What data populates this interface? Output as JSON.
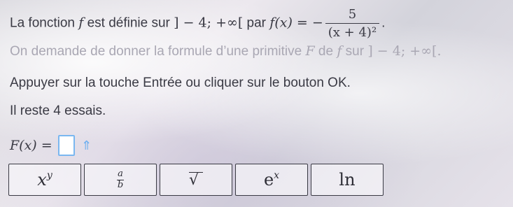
{
  "statement": {
    "text_a": "La fonction ",
    "f_symbol": "f",
    "text_b": " est définie sur ",
    "domain": "] − 4; +∞[",
    "text_c": " par ",
    "f_of_x": "f(x) = −",
    "numerator": "5",
    "denominator": "(x + 4)²",
    "end": "."
  },
  "question": {
    "text_a": "On demande de donner la formule d’une primitive ",
    "F_symbol": "F",
    "text_b": " de ",
    "f_symbol": "f",
    "text_c": " sur ",
    "domain": "] − 4; +∞[."
  },
  "instruction": "Appuyer sur la touche Entrée ou cliquer sur le bouton OK.",
  "attempts": "Il reste 4 essais.",
  "answer": {
    "label": "F(x) =",
    "value": "",
    "arrow": "⇑"
  },
  "keypad": {
    "power_base": "x",
    "power_exp": "y",
    "frac_num": "a",
    "frac_den": "b",
    "sqrt": "√",
    "exp_base": "e",
    "exp_exp": "x",
    "ln": "ln"
  },
  "colors": {
    "text": "#3a3a44",
    "faded_text": "#a9a7b3",
    "input_border": "#7ab7f0",
    "arrow": "#6aaef0"
  }
}
